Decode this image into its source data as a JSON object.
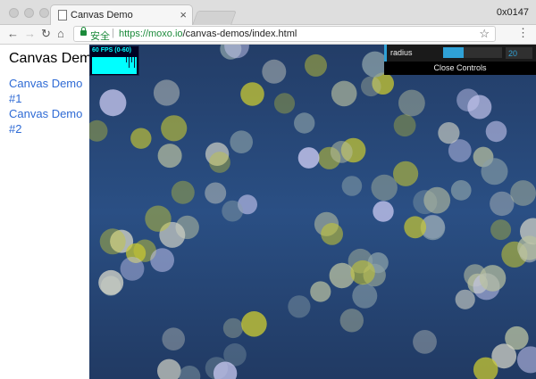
{
  "window": {
    "tab_title": "Canvas Demo",
    "tab_close_glyph": "×",
    "user_label": "0x0147"
  },
  "toolbar": {
    "back_glyph": "←",
    "forward_glyph": "→",
    "reload_glyph": "↻",
    "home_glyph": "⌂",
    "secure_label": "安全",
    "url_scheme_host": "https://moxo.io",
    "url_path": "/canvas-demos/index.html",
    "bookmark_glyph": "☆",
    "menu_glyph": "⋮"
  },
  "page": {
    "title": "Canvas Demo",
    "links": [
      {
        "label": "Canvas Demo #1"
      },
      {
        "label": "Canvas Demo #2"
      }
    ]
  },
  "stats": {
    "fps_label": "60 FPS (0-60)"
  },
  "controls": {
    "radius_label": "radius",
    "radius_value": "20",
    "radius_fraction": 0.35,
    "close_label": "Close Controls",
    "accent": "#2fa1d6"
  },
  "colors": {
    "canvas_bg": "#2a4f84",
    "bubble_yellow": "#c8c832",
    "bubble_light": "#d6d6c8",
    "bubble_lilac": "#c8c8f0",
    "link": "#2f6bd5",
    "secure_green": "#1b8a3a"
  }
}
